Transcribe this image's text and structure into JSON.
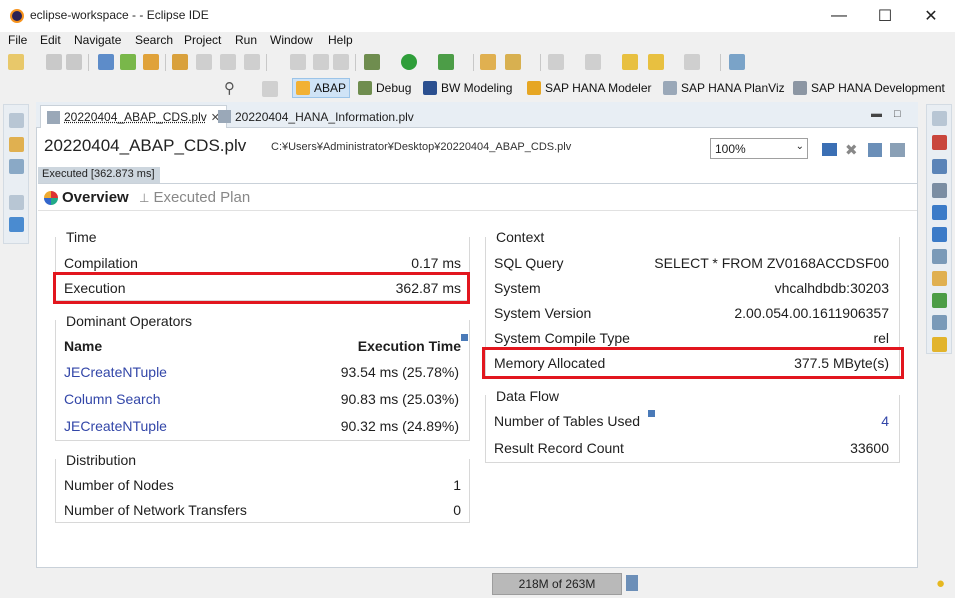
{
  "window": {
    "title": "eclipse-workspace - - Eclipse IDE",
    "minimize": "—",
    "maximize": "☐",
    "close": "✕"
  },
  "menu": [
    "File",
    "Edit",
    "Navigate",
    "Search",
    "Project",
    "Run",
    "Window",
    "Help"
  ],
  "perspectives": [
    {
      "label": "ABAP",
      "active": true
    },
    {
      "label": "Debug"
    },
    {
      "label": "BW Modeling"
    },
    {
      "label": "SAP HANA Modeler"
    },
    {
      "label": "SAP HANA PlanViz"
    },
    {
      "label": "SAP HANA Development"
    }
  ],
  "tabs": [
    {
      "label": "20220404_ABAP_CDS.plv",
      "active": true,
      "close": "✕"
    },
    {
      "label": "20220404_HANA_Information.plv",
      "active": false
    }
  ],
  "editor": {
    "file_name": "20220404_ABAP_CDS.plv",
    "file_path": "C:¥Users¥Administrator¥Desktop¥20220404_ABAP_CDS.plv",
    "zoom": "100%",
    "exec_badge": "Executed [362.873 ms]",
    "subtabs": [
      "Overview",
      "Executed Plan"
    ]
  },
  "time": {
    "title": "Time",
    "rows": [
      {
        "label": "Compilation",
        "value": "0.17 ms"
      },
      {
        "label": "Execution",
        "value": "362.87 ms"
      }
    ]
  },
  "dominant": {
    "title": "Dominant Operators",
    "col_name": "Name",
    "col_time": "Execution Time",
    "rows": [
      {
        "label": "JECreateNTuple",
        "value": "93.54 ms (25.78%)"
      },
      {
        "label": "Column Search",
        "value": "90.83 ms (25.03%)"
      },
      {
        "label": "JECreateNTuple",
        "value": "90.32 ms (24.89%)"
      }
    ]
  },
  "distribution": {
    "title": "Distribution",
    "rows": [
      {
        "label": "Number of Nodes",
        "value": "1"
      },
      {
        "label": "Number of Network Transfers",
        "value": "0"
      }
    ]
  },
  "context": {
    "title": "Context",
    "rows": [
      {
        "label": "SQL Query",
        "value": "SELECT * FROM ZV0168ACCDSF00"
      },
      {
        "label": "System",
        "value": "vhcalhdbdb:30203"
      },
      {
        "label": "System Version",
        "value": "2.00.054.00.1611906357"
      },
      {
        "label": "System Compile Type",
        "value": "rel"
      },
      {
        "label": "Memory Allocated",
        "value": "377.5 MByte(s)"
      }
    ]
  },
  "dataflow": {
    "title": "Data Flow",
    "rows": [
      {
        "label": "Number of Tables Used",
        "value": "4"
      },
      {
        "label": "Result Record Count",
        "value": "33600"
      }
    ]
  },
  "status": {
    "heap": "218M of 263M"
  },
  "colors": {
    "highlight": "#e2161e",
    "link": "#3246a8",
    "accent": "#cfe3f6"
  }
}
